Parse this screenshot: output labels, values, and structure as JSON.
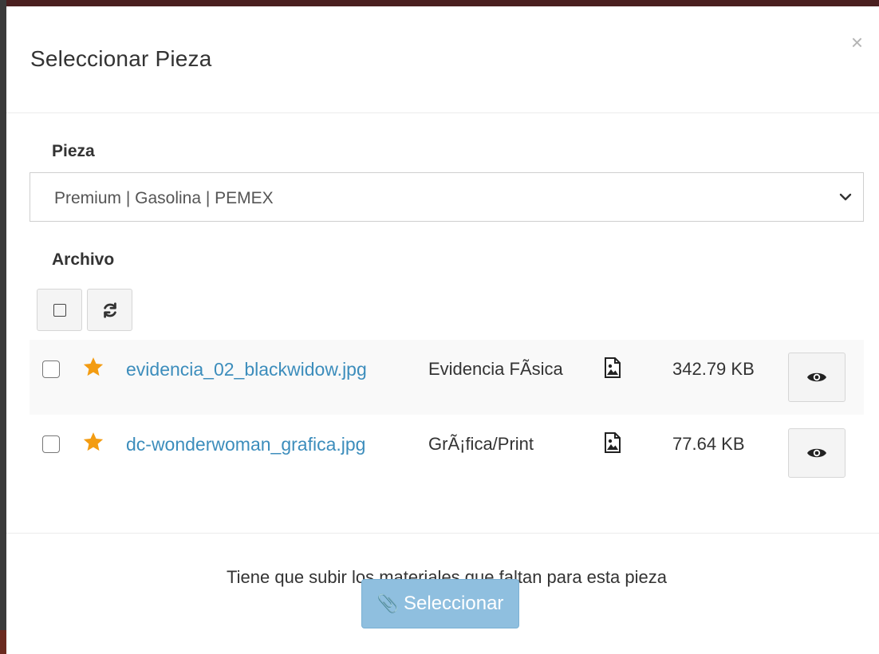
{
  "modal": {
    "title": "Seleccionar Pieza",
    "close_symbol": "×"
  },
  "pieza": {
    "label": "Pieza",
    "selected_value": "Premium | Gasolina | PEMEX"
  },
  "archivo": {
    "label": "Archivo",
    "toolbar": {
      "select_all_icon": "square-icon",
      "refresh_icon": "refresh-icon"
    },
    "files": [
      {
        "name": "evidencia_02_blackwidow.jpg",
        "type": "Evidencia FÃsica",
        "size": "342.79 KB",
        "starred": true,
        "checked": false,
        "file_icon": "image-file-icon",
        "view_icon": "eye-icon"
      },
      {
        "name": "dc-wonderwoman_grafica.jpg",
        "type": "GrÃ¡fica/Print",
        "size": "77.64 KB",
        "starred": true,
        "checked": false,
        "file_icon": "image-file-icon",
        "view_icon": "eye-icon"
      }
    ]
  },
  "footer": {
    "message": "Tiene que subir los materiales que faltan para esta pieza",
    "select_button_label": "Seleccionar",
    "select_button_icon": "paperclip-icon"
  },
  "colors": {
    "link": "#3c8dbc",
    "star": "#f39c12",
    "primary_button": "#8fbfdf",
    "row_stripe": "#f9f9f9"
  }
}
